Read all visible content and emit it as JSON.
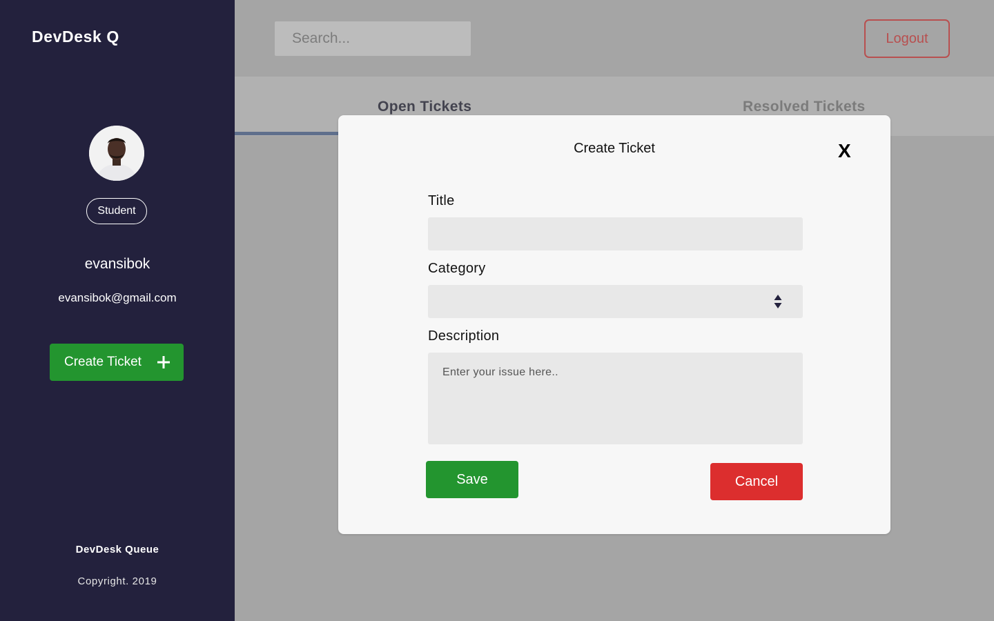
{
  "app": {
    "brand": "DevDesk Q"
  },
  "profile": {
    "role": "Student",
    "username": "evansibok",
    "email": "evansibok@gmail.com"
  },
  "sidebar": {
    "create_ticket_label": "Create Ticket",
    "footer_title": "DevDesk Queue",
    "footer_copyright": "Copyright. 2019"
  },
  "header": {
    "search_placeholder": "Search...",
    "logout_label": "Logout"
  },
  "tabs": [
    {
      "label": "Open Tickets",
      "active": true
    },
    {
      "label": "Resolved Tickets",
      "active": false
    }
  ],
  "modal": {
    "title": "Create Ticket",
    "close_label": "X",
    "fields": {
      "title_label": "Title",
      "title_value": "",
      "category_label": "Category",
      "category_value": "",
      "description_label": "Description",
      "description_placeholder": "Enter your issue here.."
    },
    "save_label": "Save",
    "cancel_label": "Cancel"
  },
  "colors": {
    "sidebar_bg": "#23213d",
    "primary_green": "#23952f",
    "danger_red": "#dc2e2e",
    "logout_red": "#b84f4f",
    "overlay_gray": "#a5a5a5"
  }
}
